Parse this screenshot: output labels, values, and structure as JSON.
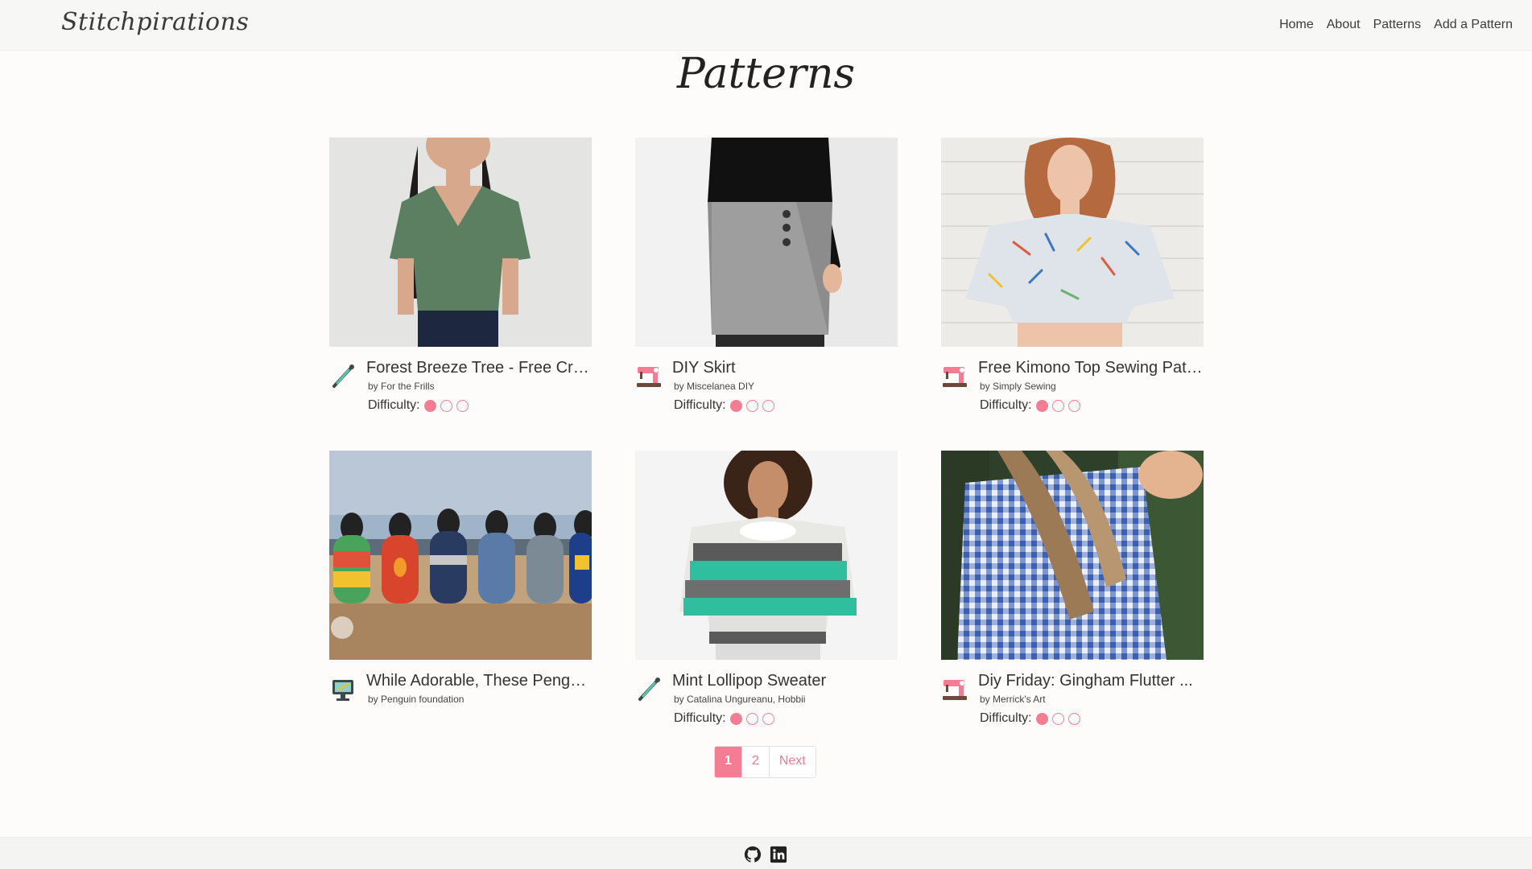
{
  "brand": "Stitchpirations",
  "nav": {
    "items": [
      {
        "label": "Home"
      },
      {
        "label": "About"
      },
      {
        "label": "Patterns"
      },
      {
        "label": "Add a Pattern"
      }
    ]
  },
  "page": {
    "title": "Patterns"
  },
  "difficulty_label": "Difficulty:",
  "colors": {
    "accent": "#f47d93",
    "navbar": "#f7f7f6",
    "footer": "#f4f4f3"
  },
  "cards": [
    {
      "title": "Forest Breeze Tree - Free Cro...",
      "author": "by For the Frills",
      "craft_icon": "crochet-hook-icon",
      "difficulty": 1,
      "show_difficulty": true
    },
    {
      "title": "DIY Skirt",
      "author": "by Miscelanea DIY",
      "craft_icon": "sewing-machine-icon",
      "difficulty": 1,
      "show_difficulty": true
    },
    {
      "title": "Free Kimono Top Sewing Patt...",
      "author": "by Simply Sewing",
      "craft_icon": "sewing-machine-icon",
      "difficulty": 1,
      "show_difficulty": true
    },
    {
      "title": "While Adorable, These Pengu...",
      "author": "by Penguin foundation",
      "craft_icon": "knitting-monitor-icon",
      "difficulty": 0,
      "show_difficulty": false
    },
    {
      "title": "Mint Lollipop Sweater",
      "author": "by Catalina Ungureanu, Hobbii",
      "craft_icon": "crochet-hook-icon",
      "difficulty": 1,
      "show_difficulty": true
    },
    {
      "title": "Diy Friday: Gingham Flutter ...",
      "author": "by Merrick's Art",
      "craft_icon": "sewing-machine-icon",
      "difficulty": 1,
      "show_difficulty": true
    }
  ],
  "pagination": {
    "pages": [
      "1",
      "2"
    ],
    "active": "1",
    "next_label": "Next"
  },
  "footer": {
    "icons": [
      "github-icon",
      "linkedin-icon"
    ]
  }
}
